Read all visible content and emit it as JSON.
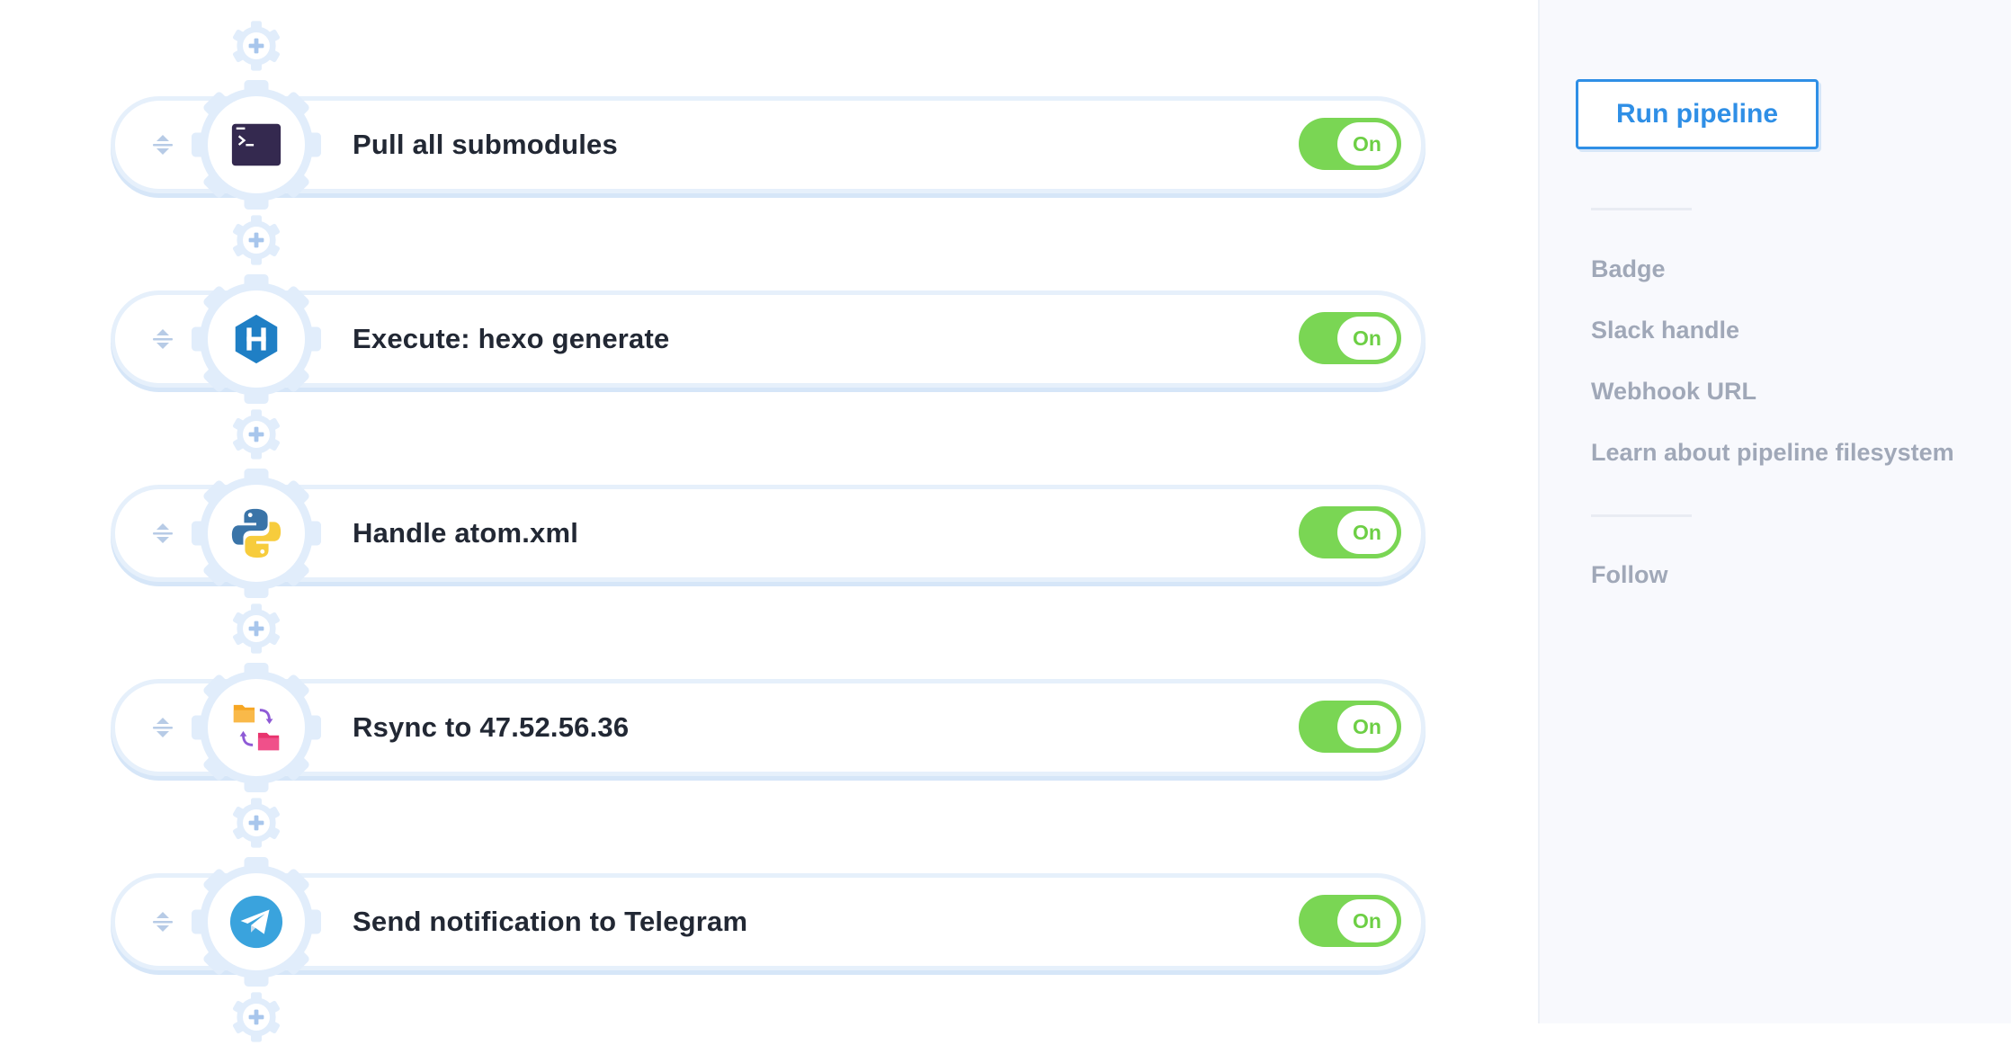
{
  "steps": [
    {
      "title": "Pull all submodules",
      "icon": "terminal-icon",
      "toggle": "On"
    },
    {
      "title": "Execute: hexo generate",
      "icon": "hexo-icon",
      "toggle": "On"
    },
    {
      "title": "Handle atom.xml",
      "icon": "python-icon",
      "toggle": "On"
    },
    {
      "title": "Rsync to 47.52.56.36",
      "icon": "rsync-folders-icon",
      "toggle": "On"
    },
    {
      "title": "Send notification to Telegram",
      "icon": "telegram-icon",
      "toggle": "On"
    }
  ],
  "sidebar": {
    "run_label": "Run pipeline",
    "links": [
      "Badge",
      "Slack handle",
      "Webhook URL",
      "Learn about pipeline filesystem"
    ],
    "follow": "Follow"
  },
  "colors": {
    "accent": "#2f8fe6",
    "toggle_on": "#7ad654",
    "gear": "#e1edfb",
    "text_dark": "#222834",
    "text_muted": "#a0a8b8"
  }
}
